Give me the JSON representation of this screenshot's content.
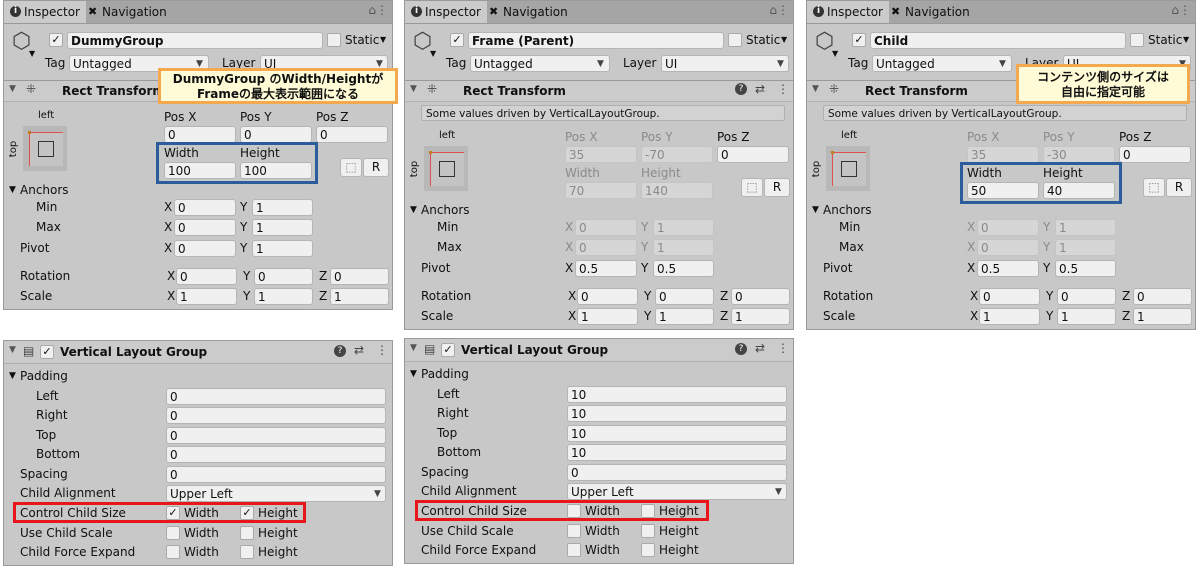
{
  "labels": {
    "tab_inspector": "Inspector",
    "tab_navigation": "Navigation",
    "static": "Static",
    "tag": "Tag",
    "layer": "Layer",
    "rect_transform": "Rect Transform",
    "left": "left",
    "top": "top",
    "pos_x": "Pos X",
    "pos_y": "Pos Y",
    "pos_z": "Pos Z",
    "width": "Width",
    "height": "Height",
    "anchors": "Anchors",
    "min": "Min",
    "max": "Max",
    "pivot": "Pivot",
    "rotation": "Rotation",
    "scale": "Scale",
    "x": "X",
    "y": "Y",
    "z": "Z",
    "r": "R",
    "vertical_layout_group": "Vertical Layout Group",
    "padding": "Padding",
    "pad_left": "Left",
    "pad_right": "Right",
    "pad_top": "Top",
    "pad_bottom": "Bottom",
    "spacing": "Spacing",
    "child_alignment": "Child Alignment",
    "control_child_size": "Control Child Size",
    "use_child_scale": "Use Child Scale",
    "child_force_expand": "Child Force Expand"
  },
  "inspectors": [
    {
      "name": "DummyGroup",
      "active": true,
      "tag": "Untagged",
      "layer": "UI",
      "driven_note": "",
      "pos": [
        "0",
        "0",
        "0"
      ],
      "size": [
        "100",
        "100"
      ],
      "anchors_min": [
        "0",
        "1"
      ],
      "anchors_max": [
        "0",
        "1"
      ],
      "pivot": [
        "0",
        "1"
      ],
      "rotation": [
        "0",
        "0",
        "0"
      ],
      "scale": [
        "1",
        "1",
        "1"
      ],
      "pos_xy_driven": false,
      "size_driven": false,
      "anchors_driven": false,
      "callout": "DummyGroup のWidth/Heightが\nFrameの最大表示範囲になる"
    },
    {
      "name": "Frame (Parent)",
      "active": true,
      "tag": "Untagged",
      "layer": "UI",
      "driven_note": "Some values driven by VerticalLayoutGroup.",
      "pos": [
        "35",
        "-70",
        "0"
      ],
      "size": [
        "70",
        "140"
      ],
      "anchors_min": [
        "0",
        "1"
      ],
      "anchors_max": [
        "0",
        "1"
      ],
      "pivot": [
        "0.5",
        "0.5"
      ],
      "rotation": [
        "0",
        "0",
        "0"
      ],
      "scale": [
        "1",
        "1",
        "1"
      ],
      "pos_xy_driven": true,
      "size_driven": true,
      "anchors_driven": true,
      "callout": ""
    },
    {
      "name": "Child",
      "active": true,
      "tag": "Untagged",
      "layer": "UI",
      "driven_note": "Some values driven by VerticalLayoutGroup.",
      "pos": [
        "35",
        "-30",
        "0"
      ],
      "size": [
        "50",
        "40"
      ],
      "anchors_min": [
        "0",
        "1"
      ],
      "anchors_max": [
        "0",
        "1"
      ],
      "pivot": [
        "0.5",
        "0.5"
      ],
      "rotation": [
        "0",
        "0",
        "0"
      ],
      "scale": [
        "1",
        "1",
        "1"
      ],
      "pos_xy_driven": true,
      "size_driven": false,
      "anchors_driven": true,
      "callout": "コンテンツ側のサイズは\n自由に指定可能"
    }
  ],
  "layout_groups": [
    {
      "enabled": true,
      "padding": {
        "left": "0",
        "right": "0",
        "top": "0",
        "bottom": "0"
      },
      "spacing": "0",
      "child_alignment": "Upper Left",
      "control_child_size": {
        "width": true,
        "height": true
      },
      "use_child_scale": {
        "width": false,
        "height": false
      },
      "child_force_expand": {
        "width": false,
        "height": false
      }
    },
    {
      "enabled": true,
      "padding": {
        "left": "10",
        "right": "10",
        "top": "10",
        "bottom": "10"
      },
      "spacing": "0",
      "child_alignment": "Upper Left",
      "control_child_size": {
        "width": false,
        "height": false
      },
      "use_child_scale": {
        "width": false,
        "height": false
      },
      "child_force_expand": {
        "width": false,
        "height": false
      }
    }
  ],
  "colors": {
    "callout_border": "#f5a94e",
    "callout_fill": "#fffbd6",
    "highlight_blue": "#2b5c9b",
    "highlight_red": "#e8161b"
  }
}
